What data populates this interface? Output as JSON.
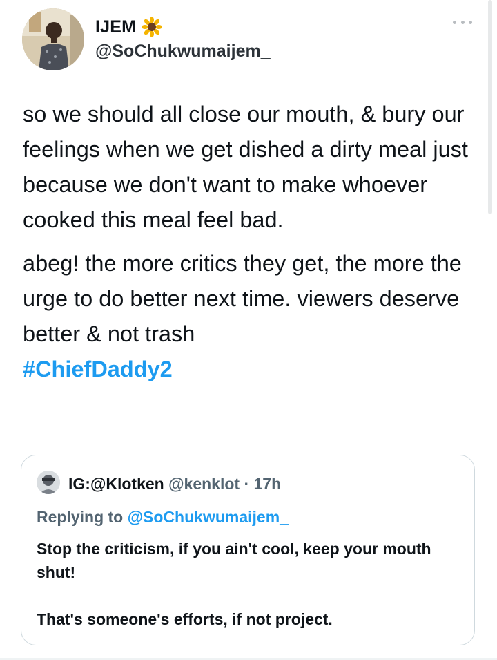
{
  "tweet": {
    "display_name": "IJEM",
    "name_emoji": "sunflower-icon",
    "handle": "@SoChukwumaijem_",
    "paragraph_1": "so we should all close our mouth, & bury our feelings when we get dished a dirty meal just because we don't want to make whoever cooked this meal feel bad.",
    "paragraph_2": "abeg! the more critics they get, the more the urge to do better next time. viewers deserve better & not trash",
    "hashtag": "#ChiefDaddy2"
  },
  "quoted": {
    "name": "IG:@Klotken",
    "handle": "@kenklot",
    "separator": "·",
    "time": "17h",
    "replying_prefix": "Replying to",
    "replying_handle": "@SoChukwumaijem_",
    "text_1": "Stop the criticism, if you ain't cool, keep your mouth shut!",
    "text_2": "That's someone's efforts, if not project."
  },
  "colors": {
    "link": "#1d9bf0",
    "secondary": "#536471",
    "border": "#cfd9de"
  }
}
